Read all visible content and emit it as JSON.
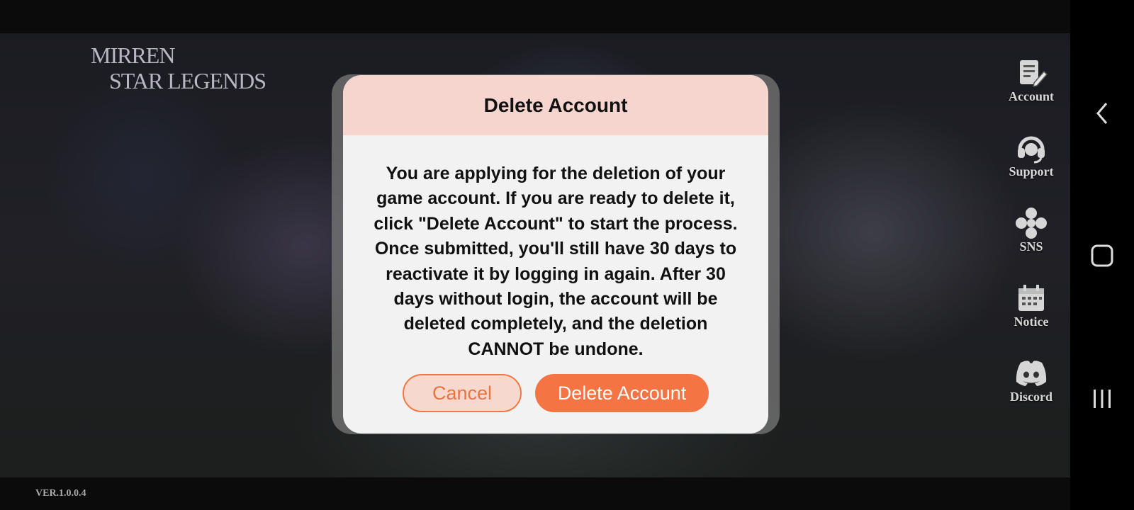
{
  "game": {
    "logo_line1": "MIRREN",
    "logo_line2": "STAR LEGENDS",
    "version": "VER.1.0.0.4"
  },
  "side_menu": [
    {
      "label": "Account",
      "icon": "account-edit-icon"
    },
    {
      "label": "Support",
      "icon": "headset-icon"
    },
    {
      "label": "SNS",
      "icon": "sns-icon"
    },
    {
      "label": "Notice",
      "icon": "calendar-icon"
    },
    {
      "label": "Discord",
      "icon": "discord-icon"
    }
  ],
  "dialog": {
    "title": "Delete Account",
    "message": "You are applying for the deletion of your game account. If you are ready to delete it, click \"Delete Account\" to start the process. Once submitted, you'll still have 30 days to reactivate it by logging in again. After 30 days without login, the account will be deleted completely, and the deletion CANNOT be undone.",
    "cancel_label": "Cancel",
    "confirm_label": "Delete Account"
  },
  "colors": {
    "header_bg": "#f6d5cf",
    "accent": "#f47444",
    "dialog_bg": "#f2f2f2"
  },
  "system_nav": [
    "back-icon",
    "home-icon",
    "recents-icon"
  ]
}
